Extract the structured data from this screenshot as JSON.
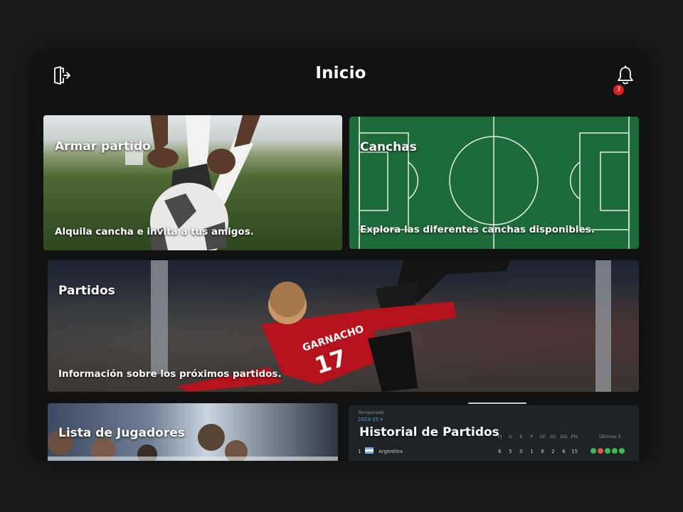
{
  "header": {
    "title": "Inicio",
    "notification_count": "3",
    "logout_icon": "logout-icon",
    "bell_icon": "bell-icon"
  },
  "cards": {
    "armar": {
      "title": "Armar partido",
      "description": "Alquila cancha e invita a tus amigos."
    },
    "canchas": {
      "title": "Canchas",
      "description": "Explora las diferentes canchas disponibles."
    },
    "partidos": {
      "title": "Partidos",
      "description": "Información sobre los próximos partidos.",
      "jersey_name": "GARNACHO",
      "jersey_number": "17"
    },
    "lista": {
      "title": "Lista de Jugadores"
    },
    "historial": {
      "title": "Historial de Partidos",
      "season_label": "Temporada",
      "season_value": "2023-25 ▾",
      "columns": [
        "PJ",
        "G",
        "E",
        "P",
        "GF",
        "GC",
        "DG",
        "Pts"
      ],
      "last_label": "Últimos 5",
      "row": {
        "position": "1",
        "team": "Argentina",
        "stats": [
          "6",
          "5",
          "0",
          "1",
          "8",
          "2",
          "6",
          "15"
        ],
        "last5": [
          "win",
          "loss",
          "win",
          "win",
          "win"
        ]
      }
    }
  },
  "colors": {
    "background": "#1b1b1b",
    "device": "#111111",
    "pitch": "#1e6b3a",
    "badge": "#d91e1e",
    "win": "#3fb950",
    "loss": "#e5534b"
  }
}
